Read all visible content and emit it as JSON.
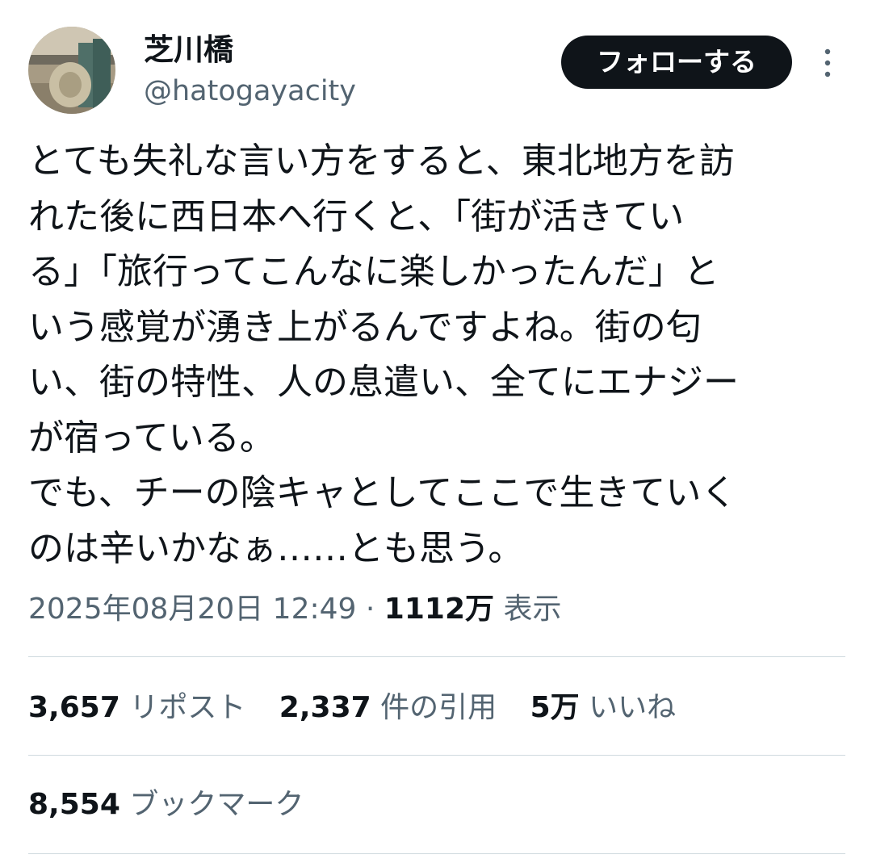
{
  "author": {
    "display_name": "芝川橋",
    "handle": "@hatogayacity",
    "avatar_icon": "avatar-photo"
  },
  "actions": {
    "follow_label": "フォローする",
    "more_icon": "more-vertical-icon"
  },
  "tweet": {
    "lines": [
      "とても失礼な言い方をすると、東北地方を訪",
      "れた後に西日本へ行くと、「街が活きてい",
      "る」「旅行ってこんなに楽しかったんだ」と",
      "いう感覚が湧き上がるんですよね。街の匂",
      "い、街の特性、人の息遣い、全てにエナジー",
      "が宿っている。",
      "でも、チーの陰キャとしてここで生きていく",
      "のは辛いかなぁ……とも思う。"
    ]
  },
  "meta": {
    "timestamp": "2025年08月20日 12:49",
    "separator": "·",
    "views_count": "1112万",
    "views_label": "表示"
  },
  "stats": {
    "reposts_count": "3,657",
    "reposts_label": "リポスト",
    "quotes_count": "2,337",
    "quotes_label": "件の引用",
    "likes_count": "5万",
    "likes_label": "いいね",
    "bookmarks_count": "8,554",
    "bookmarks_label": "ブックマーク"
  },
  "colors": {
    "text_primary": "#0f1419",
    "text_secondary": "#536471",
    "divider": "#cfd9de",
    "button_bg": "#0f1419"
  }
}
